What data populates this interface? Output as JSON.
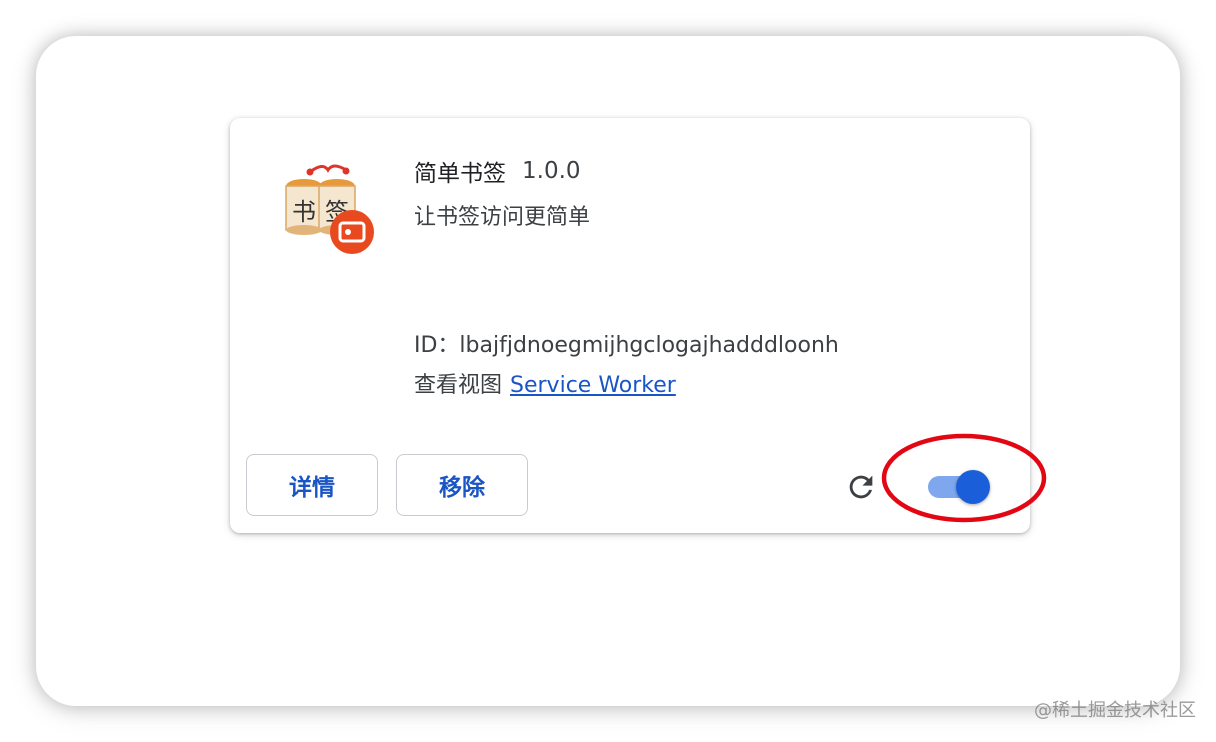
{
  "extension": {
    "name": "简单书签",
    "version": "1.0.0",
    "description": "让书签访问更简单",
    "id_line": "ID：lbajfjdnoegmijhgclogajhadddloonh",
    "inspect_label": "查看视图",
    "inspect_link": "Service Worker",
    "icon_chars": [
      "书",
      "签"
    ],
    "enabled": true
  },
  "actions": {
    "details_label": "详情",
    "remove_label": "移除",
    "reload_icon": "reload-icon"
  },
  "colors": {
    "accent_blue": "#1a55c6",
    "toggle_knob": "#1a5fd9",
    "toggle_track": "#7fa7ee",
    "annotation_red": "#e30613",
    "badge_orange": "#e8491f"
  },
  "watermark": "@稀土掘金技术社区"
}
